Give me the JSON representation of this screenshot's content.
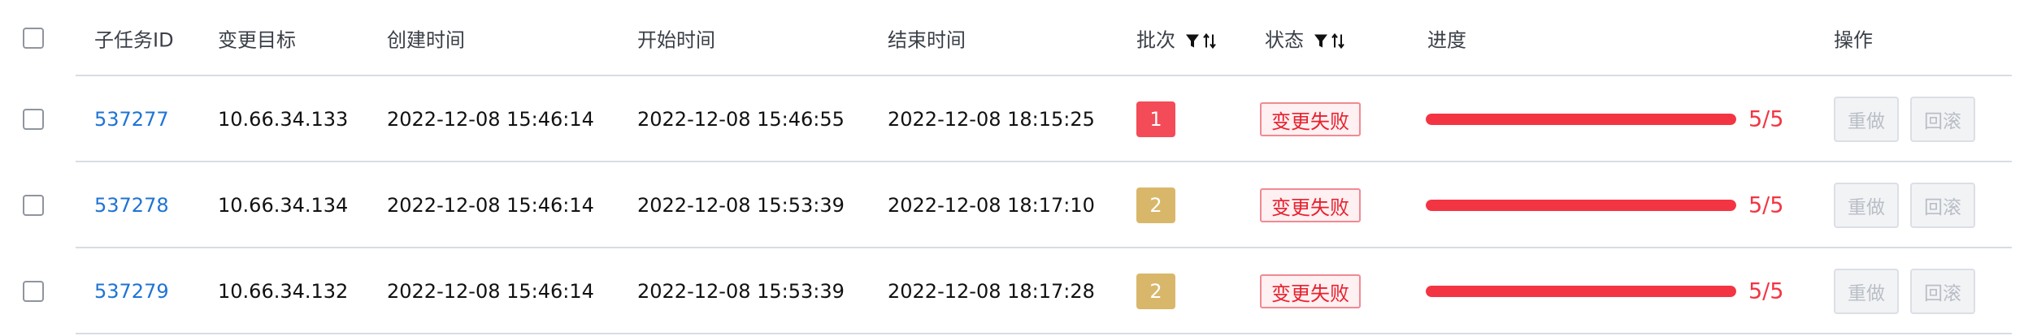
{
  "columns": {
    "id": "子任务ID",
    "target": "变更目标",
    "created": "创建时间",
    "start": "开始时间",
    "end": "结束时间",
    "batch": "批次",
    "status": "状态",
    "progress": "进度",
    "actions": "操作"
  },
  "rows": [
    {
      "id": "537277",
      "target": "10.66.34.133",
      "created": "2022-12-08 15:46:14",
      "start": "2022-12-08 15:46:55",
      "end": "2022-12-08 18:15:25",
      "batch": "1",
      "batch_color": "#f34b58",
      "status": "变更失败",
      "progress_fraction": 1.0,
      "progress_text": "5/5",
      "redo_label": "重做",
      "rollback_label": "回滚"
    },
    {
      "id": "537278",
      "target": "10.66.34.134",
      "created": "2022-12-08 15:46:14",
      "start": "2022-12-08 15:53:39",
      "end": "2022-12-08 18:17:10",
      "batch": "2",
      "batch_color": "#d9b76a",
      "status": "变更失败",
      "progress_fraction": 1.0,
      "progress_text": "5/5",
      "redo_label": "重做",
      "rollback_label": "回滚"
    },
    {
      "id": "537279",
      "target": "10.66.34.132",
      "created": "2022-12-08 15:46:14",
      "start": "2022-12-08 15:53:39",
      "end": "2022-12-08 18:17:28",
      "batch": "2",
      "batch_color": "#d9b76a",
      "status": "变更失败",
      "progress_fraction": 1.0,
      "progress_text": "5/5",
      "redo_label": "重做",
      "rollback_label": "回滚"
    }
  ],
  "colors": {
    "link": "#1f73d6",
    "progress": "#f33543",
    "status_text": "#e8212f",
    "status_border": "#f08a93",
    "status_bg": "#fff0f1"
  },
  "icons": {
    "batch_filter": "filter-icon",
    "batch_sort": "sort-icon",
    "status_filter": "filter-icon",
    "status_sort": "sort-icon"
  }
}
